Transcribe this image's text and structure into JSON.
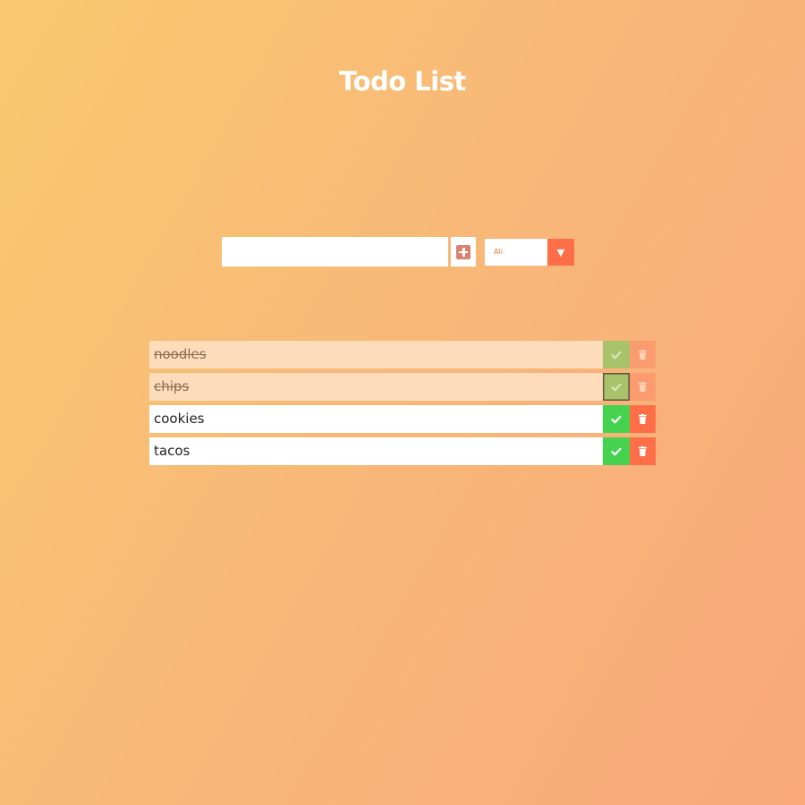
{
  "header": {
    "title": "Todo List"
  },
  "form": {
    "input_value": "",
    "input_placeholder": "",
    "add_icon": "plus-square-icon",
    "filter_selected": "All",
    "filter_arrow_icon": "caret-down-icon"
  },
  "todos": [
    {
      "text": "noodles",
      "completed": true,
      "focused": false
    },
    {
      "text": "chips",
      "completed": true,
      "focused": true
    },
    {
      "text": "cookies",
      "completed": false,
      "focused": false
    },
    {
      "text": "tacos",
      "completed": false,
      "focused": false
    }
  ],
  "icons": {
    "check": "check-icon",
    "trash": "trash-icon"
  },
  "colors": {
    "background_start": "#f9c96f",
    "background_end": "#faa87a",
    "accent": "#ff6f47",
    "complete_green": "#45d34f",
    "add_icon": "#d9826f",
    "completed_row": "#fcdcbb"
  }
}
